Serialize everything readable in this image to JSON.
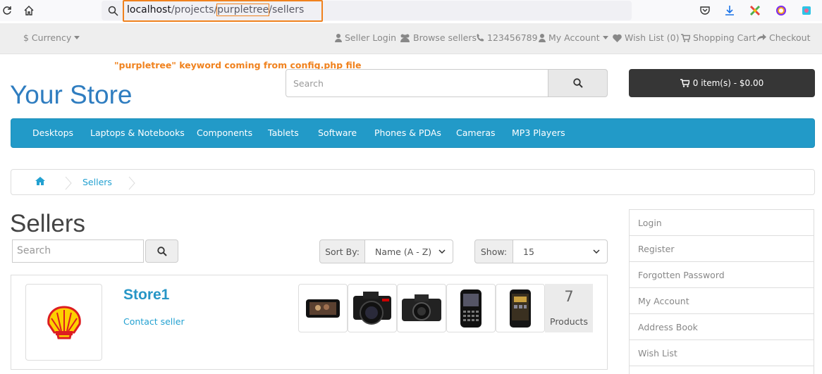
{
  "browser": {
    "url_host": "localhost",
    "url_path_1": "/projects/",
    "url_keyword": "purpletree",
    "url_path_2": "/sellers"
  },
  "topbar": {
    "currency": "$ Currency",
    "seller_login": "Seller Login",
    "browse_sellers": "Browse sellers",
    "phone": "123456789",
    "my_account": "My Account",
    "wish_list": "Wish List (0)",
    "shopping_cart": "Shopping Cart",
    "checkout": "Checkout"
  },
  "annotation": "\"purpletree\" keyword coming from config.php file",
  "header": {
    "logo_text": "Your Store",
    "search_placeholder": "Search",
    "cart_button": "0 item(s) - $0.00"
  },
  "menu": {
    "items": [
      "Desktops",
      "Laptops & Notebooks",
      "Components",
      "Tablets",
      "Software",
      "Phones & PDAs",
      "Cameras",
      "MP3 Players"
    ]
  },
  "breadcrumb": {
    "home_icon": "home-icon",
    "current": "Sellers"
  },
  "page": {
    "title": "Sellers",
    "search_placeholder": "Search",
    "sort_label": "Sort By:",
    "sort_value": "Name (A - Z)",
    "show_label": "Show:",
    "show_value": "15"
  },
  "seller": {
    "name": "Store1",
    "contact": "Contact seller",
    "logo": "shell-logo",
    "products_count": "7",
    "products_label": "Products",
    "thumbnails": [
      "phone-landscape",
      "dslr-camera",
      "camera",
      "smartphone-keyboard",
      "smartphone-touch"
    ]
  },
  "sidebar": {
    "items": [
      "Login",
      "Register",
      "Forgotten Password",
      "My Account",
      "Address Book",
      "Wish List"
    ]
  },
  "colors": {
    "accent_orange": "#f0821e",
    "menu_blue": "#229ac8",
    "link_blue": "#23a1d1",
    "logo_blue": "#2f7dc0",
    "cart_dark": "#363636"
  }
}
